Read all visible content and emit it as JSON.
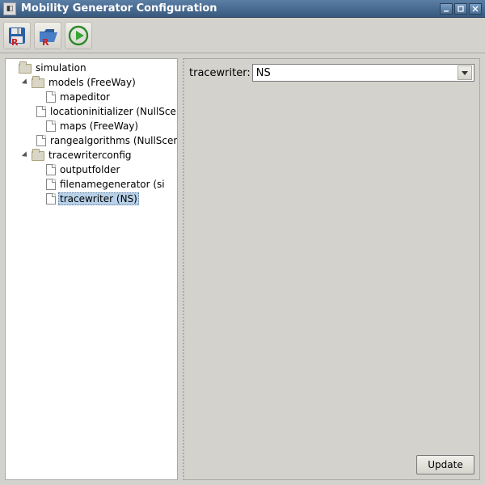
{
  "window": {
    "title": "Mobility Generator Configuration"
  },
  "toolbar": {
    "save_recent_icon": "save-r",
    "open_recent_icon": "folder-r",
    "run_icon": "play"
  },
  "tree": {
    "root": {
      "label": "simulation",
      "children": [
        {
          "label": "models (FreeWay)",
          "children": [
            {
              "label": "mapeditor"
            },
            {
              "label": "locationinitializer (NullScenario)"
            },
            {
              "label": "maps (FreeWay)"
            },
            {
              "label": "rangealgorithms (NullScenario)"
            }
          ]
        },
        {
          "label": "tracewriterconfig",
          "children": [
            {
              "label": "outputfolder"
            },
            {
              "label": "filenamegenerator (si"
            },
            {
              "label": "tracewriter (NS)",
              "selected": true
            }
          ]
        }
      ]
    }
  },
  "form": {
    "label": "tracewriter:",
    "value": "NS"
  },
  "buttons": {
    "update": "Update"
  }
}
